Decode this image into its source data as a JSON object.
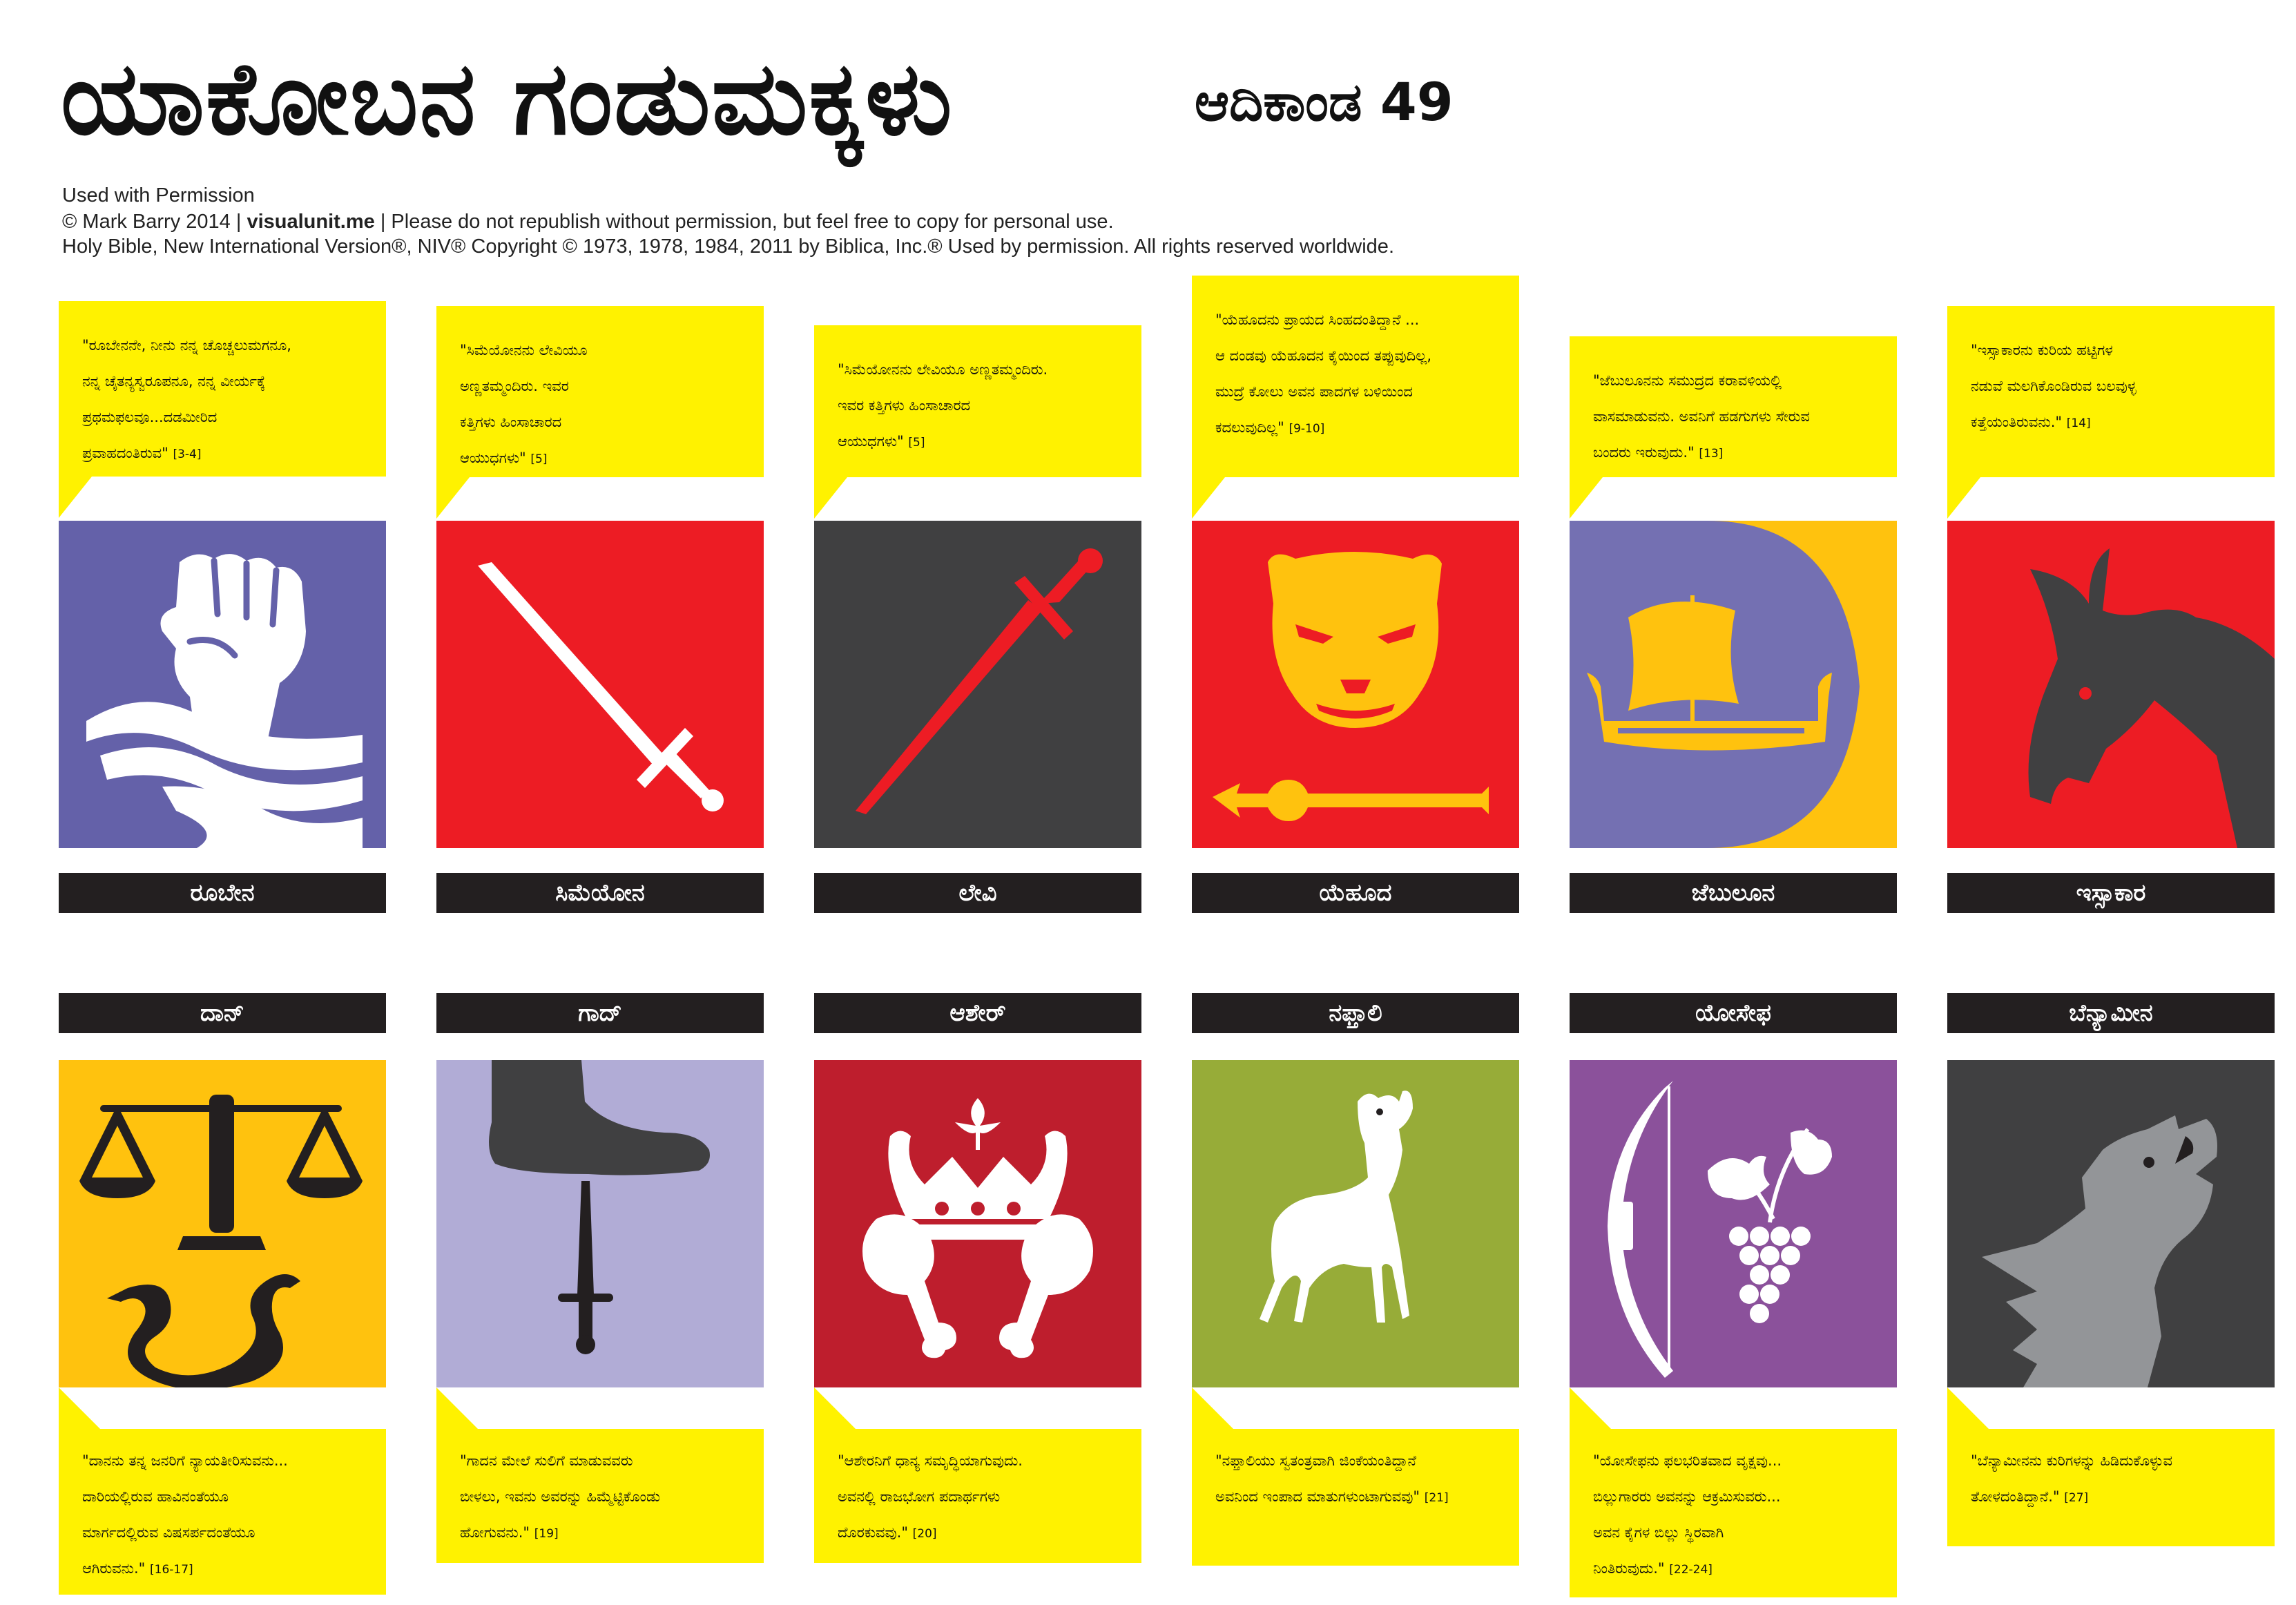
{
  "header": {
    "title": "ಯಾಕೋಬನ ಗಂಡುಮಕ್ಕಳು",
    "chapter": "ಆದಿಕಾಂಡ 49"
  },
  "credits": {
    "line1": "Used  with  Permission",
    "line2_a": "© Mark Barry 2014  |  ",
    "line2_b": "visualunit.me",
    "line2_c": "  |  Please do not republish without permission, but feel free to copy for personal use.",
    "line3": "Holy Bible, New International Version®, NIV® Copyright © 1973, 1978, 1984, 2011 by Biblica, Inc.® Used by permission. All rights reserved worldwide."
  },
  "top_row": [
    {
      "name": "ರೂಬೇನ",
      "icon": "fist-water-icon",
      "bg": "#6461a9",
      "quote": [
        "\"ರೂಬೇನನೇ, ನೀನು ನನ್ನ ಚೊಚ್ಚಲುಮಗನೂ,",
        "ನನ್ನ ಚೈತನ್ಯಸ್ವರೂಪನೂ, ನನ್ನ ವೀರ್ಯಕ್ಕೆ",
        "ಪ್ರಥಮಫಲವೂ...ದಡಮೀರಿದ",
        "ಪ್ರವಾಹದಂತಿರುವ\""
      ],
      "ref": "[3-4]"
    },
    {
      "name": "ಸಿಮೆಯೋನ",
      "icon": "sword-icon",
      "bg": "#ed1c24",
      "quote": [
        "\"ಸಿಮೆಯೋನನು ಲೇವಿಯೂ",
        "ಅಣ್ಣತಮ್ಮಂದಿರು. ಇವರ",
        "ಕತ್ತಿಗಳು ಹಿಂಸಾಚಾರದ",
        "ಆಯುಧಗಳು\""
      ],
      "ref": "[5]"
    },
    {
      "name": "ಲೇವಿ",
      "icon": "red-sword-icon",
      "bg": "#404041",
      "quote": [
        "\"ಸಿಮೆಯೋನನು ಲೇವಿಯೂ ಅಣ್ಣತಮ್ಮಂದಿರು.",
        "ಇವರ ಕತ್ತಿಗಳು ಹಿಂಸಾಚಾರದ",
        "ಆಯುಧಗಳು\""
      ],
      "ref": "[5]"
    },
    {
      "name": "ಯೆಹೂದ",
      "icon": "lion-scepter-icon",
      "bg": "#ed1c24",
      "quote": [
        "\"ಯೆಹೂದನು ಪ್ರಾಯದ ಸಿಂಹದಂತಿದ್ದಾನೆ ...",
        "ಆ ದಂಡವು ಯೆಹೂದನ ಕೈಯಿಂದ ತಪ್ಪುವುದಿಲ್ಲ,",
        "ಮುದ್ರೆ ಕೋಲು ಅವನ ಪಾದಗಳ ಬಳಿಯಿಂದ",
        "ಕದಲುವುದಿಲ್ಲ\""
      ],
      "ref": "[9-10]"
    },
    {
      "name": "ಜೆಬುಲೂನ",
      "icon": "ship-harbor-icon",
      "bg": "#7470b2",
      "quote": [
        "\"ಜೆಬುಲೂನನು ಸಮುದ್ರದ ಕರಾವಳಿಯಲ್ಲಿ",
        "ವಾಸಮಾಡುವನು. ಅವನಿಗೆ ಹಡಗುಗಳು ಸೇರುವ",
        "ಬಂದರು ಇರುವುದು.\""
      ],
      "ref": "[13]"
    },
    {
      "name": "ಇಸ್ಸಾಕಾರ",
      "icon": "donkey-icon",
      "bg": "#ed1c24",
      "quote": [
        "\"ಇಸ್ಸಾಕಾರನು ಕುರಿಯ ಹಟ್ಟಿಗಳ",
        "ನಡುವೆ ಮಲಗಿಕೊಂಡಿರುವ ಬಲವುಳ್ಳ",
        "ಕತ್ತೆಯಂತಿರುವನು.\""
      ],
      "ref": "[14]"
    }
  ],
  "bottom_row": [
    {
      "name": "ದಾನ್",
      "icon": "scales-serpent-icon",
      "bg": "#ffc20e",
      "quote": [
        "\"ದಾನನು ತನ್ನ ಜನರಿಗೆ ನ್ಯಾಯತೀರಿಸುವನು...",
        "ದಾರಿಯಲ್ಲಿರುವ ಹಾವಿನಂತೆಯೂ",
        "ಮಾರ್ಗದಲ್ಲಿರುವ ವಿಷಸರ್ಪದಂತೆಯೂ",
        "ಆಗಿರುವನು.\""
      ],
      "ref": "[16-17]"
    },
    {
      "name": "ಗಾದ್",
      "icon": "heel-dagger-icon",
      "bg": "#b1acd6",
      "quote": [
        "\"ಗಾದನ ಮೇಲೆ ಸುಲಿಗೆ ಮಾಡುವವರು",
        "ಬೀಳಲು, ಇವನು ಅವರನ್ನು ಹಿಮ್ಮೆಟ್ಟಿಕೊಂಡು",
        "ಹೋಗುವನು.\""
      ],
      "ref": "[19]"
    },
    {
      "name": "ಆಶೇರ್",
      "icon": "crown-drumsticks-icon",
      "bg": "#be1e2d",
      "quote": [
        "\"ಆಶೇರನಿಗೆ ಧಾನ್ಯ ಸಮೃದ್ಧಿಯಾಗುವುದು.",
        "ಅವನಲ್ಲಿ ರಾಜಭೋಗ ಪದಾರ್ಥಗಳು",
        "ದೊರಕುವವು.\""
      ],
      "ref": "[20]"
    },
    {
      "name": "ನಫ್ತಾಲಿ",
      "icon": "doe-icon",
      "bg": "#97ac38",
      "quote": [
        "\"ನಫ್ತಾಲಿಯು ಸ್ವತಂತ್ರವಾಗಿ ಜಿಂಕೆಯಂತಿದ್ದಾನೆ",
        "ಅವನಿಂದ ಇಂಪಾದ ಮಾತುಗಳುಂಟಾಗುವವು\""
      ],
      "ref": "[21]"
    },
    {
      "name": "ಯೋಸೇಫ",
      "icon": "bow-grapes-icon",
      "bg": "#8b519b",
      "quote": [
        "\"ಯೋಸೇಫನು ಫಲಭರಿತವಾದ ವೃಕ್ಷವು...",
        "ಬಿಲ್ಲುಗಾರರು ಅವನನ್ನು ಆಕ್ರಮಿಸುವರು...",
        "ಅವನ ಕೈಗಳ ಬಿಲ್ಲು ಸ್ಥಿರವಾಗಿ",
        "ನಿಂತಿರುವುದು.\""
      ],
      "ref": "[22-24]"
    },
    {
      "name": "ಬೆನ್ಯಾಮೀನ",
      "icon": "wolf-icon",
      "bg": "#404041",
      "quote": [
        "\"ಬೆನ್ಯಾಮೀನನು ಕುರಿಗಳನ್ನು ಹಿಡಿದುಕೊಳ್ಳುವ",
        "ತೋಳದಂತಿದ್ದಾನೆ.\""
      ],
      "ref": "[27]"
    }
  ],
  "colors": {
    "yellow": "#fff200",
    "label_bg": "#231f20"
  }
}
